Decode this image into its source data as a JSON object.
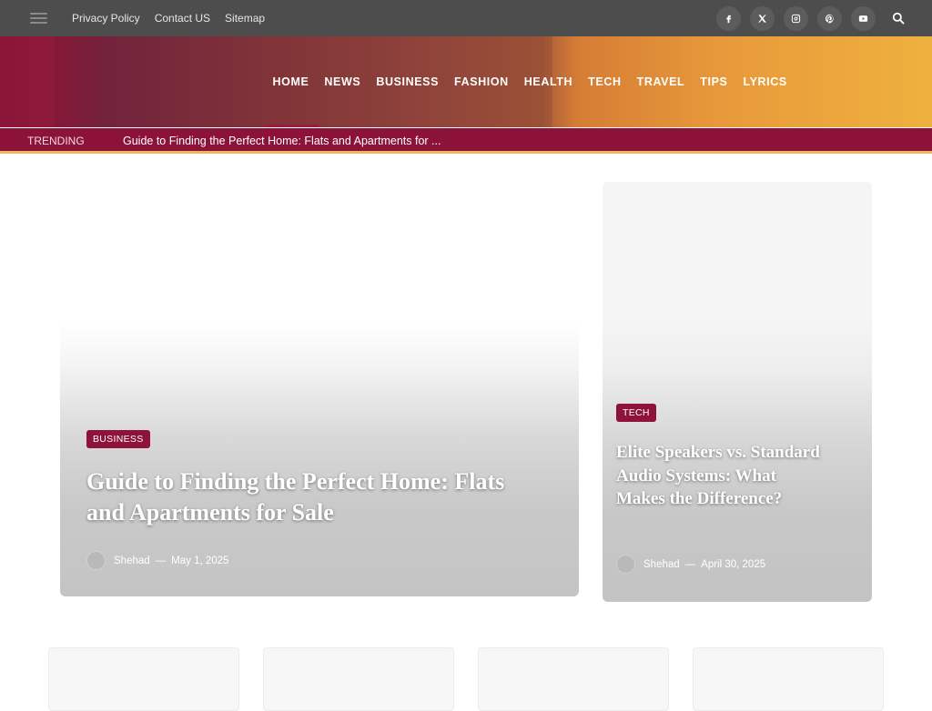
{
  "topbar": {
    "links": [
      "Privacy Policy",
      "Contact US",
      "Sitemap"
    ],
    "social_icons": [
      "facebook-icon",
      "x-icon",
      "instagram-icon",
      "pinterest-icon",
      "youtube-icon"
    ]
  },
  "nav": {
    "items": [
      "HOME",
      "NEWS",
      "BUSINESS",
      "FASHION",
      "HEALTH",
      "TECH",
      "TRAVEL",
      "TIPS",
      "LYRICS"
    ],
    "active": "HOME"
  },
  "trending": {
    "label": "TRENDING",
    "headline": "Guide to Finding the Perfect Home: Flats and Apartments for ..."
  },
  "featured": {
    "main": {
      "category": "BUSINESS",
      "title": "Guide to Finding the Perfect Home: Flats and Apartments for Sale",
      "author": "Shehad",
      "separator": "—",
      "date": "May 1, 2025"
    },
    "side": {
      "category": "TECH",
      "title": "Elite Speakers vs. Standard Audio Systems: What Makes the Difference?",
      "author": "Shehad",
      "separator": "—",
      "date": "April 30, 2025"
    }
  },
  "colors": {
    "accent": "#8e1239",
    "topbar": "#4d4d4d",
    "trending_border": "#f2b45a"
  }
}
